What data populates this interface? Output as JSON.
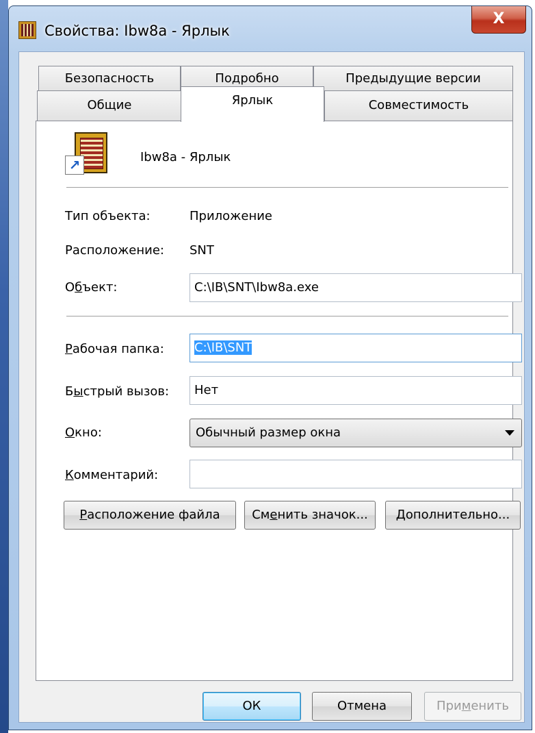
{
  "window": {
    "title": "Свойства: Ibw8a - Ярлык",
    "close_label": "X"
  },
  "tabs": {
    "row1": [
      "Безопасность",
      "Подробно",
      "Предыдущие версии"
    ],
    "row2": [
      "Общие",
      "Ярлык",
      "Совместимость"
    ],
    "active": "Ярлык"
  },
  "shortcut": {
    "icon": "shortcut-app-icon",
    "name": "Ibw8a - Ярлык"
  },
  "fields": {
    "type_label": "Тип объекта:",
    "type_value": "Приложение",
    "location_label": "Расположение:",
    "location_value": "SNT",
    "target_label_pre": "О",
    "target_label_ul": "б",
    "target_label_post": "ъект:",
    "target_value": "C:\\IB\\SNT\\Ibw8a.exe",
    "workdir_label_pre": "",
    "workdir_label_ul": "Р",
    "workdir_label_post": "абочая папка:",
    "workdir_value": "C:\\IB\\SNT",
    "hotkey_label_pre": "Б",
    "hotkey_label_ul": "ы",
    "hotkey_label_post": "стрый вызов:",
    "hotkey_value": "Нет",
    "run_label_pre": "",
    "run_label_ul": "О",
    "run_label_post": "кно:",
    "run_value": "Обычный размер окна",
    "comment_label_pre": "",
    "comment_label_ul": "К",
    "comment_label_post": "омментарий:",
    "comment_value": ""
  },
  "buttons": {
    "open_location_pre": "",
    "open_location_ul": "Р",
    "open_location_post": "асположение файла",
    "change_icon_pre": "См",
    "change_icon_ul": "е",
    "change_icon_post": "нить значок...",
    "advanced_pre": "",
    "advanced_ul": "Д",
    "advanced_post": "ополнительно...",
    "ok": "ОК",
    "cancel": "Отмена",
    "apply_pre": "При",
    "apply_ul": "м",
    "apply_post": "енить"
  }
}
